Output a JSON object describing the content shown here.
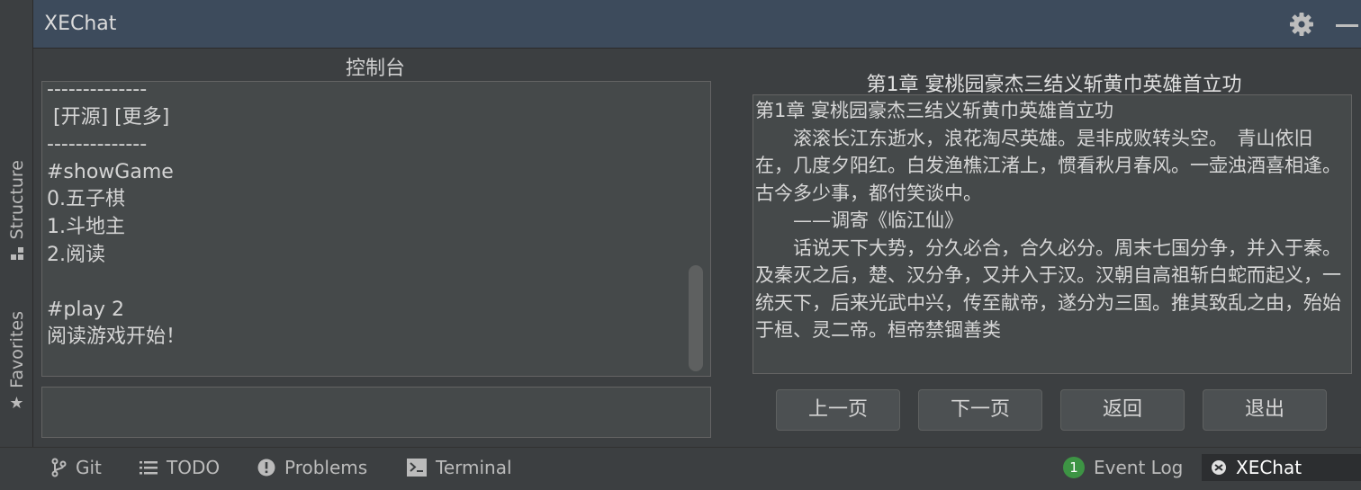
{
  "window": {
    "title": "XEChat",
    "gear_icon": "gear-icon",
    "minimize_icon": "minimize-icon"
  },
  "left_strip": {
    "structure_label": "Structure",
    "favorites_label": "Favorites"
  },
  "console": {
    "heading": "控制台",
    "lines": [
      "--------------",
      " [开源] [更多]",
      "--------------",
      "#showGame",
      "0.五子棋",
      "1.斗地主",
      "2.阅读",
      "",
      "#play 2",
      "阅读游戏开始！"
    ],
    "input_value": ""
  },
  "reader": {
    "heading": "第1章 宴桃园豪杰三结义斩黄巾英雄首立功",
    "paragraphs": [
      "第1章 宴桃园豪杰三结义斩黄巾英雄首立功",
      "　　滚滚长江东逝水，浪花淘尽英雄。是非成败转头空。　青山依旧在，几度夕阳红。白发渔樵江渚上，惯看秋月春风。一壶浊酒喜相逢。古今多少事，都付笑谈中。",
      "　　——调寄《临江仙》",
      "　　话说天下大势，分久必合，合久必分。周末七国分争，并入于秦。及秦灭之后，楚、汉分争，又并入于汉。汉朝自高祖斩白蛇而起义，一统天下，后来光武中兴，传至献帝，遂分为三国。推其致乱之由，殆始于桓、灵二帝。桓帝禁锢善类"
    ],
    "buttons": {
      "prev": "上一页",
      "next": "下一页",
      "back": "返回",
      "exit": "退出"
    }
  },
  "statusbar": {
    "git": "Git",
    "todo": "TODO",
    "problems": "Problems",
    "terminal": "Terminal",
    "event_log": "Event Log",
    "event_log_count": "1",
    "xechat": "XEChat"
  },
  "colors": {
    "title_bar": "#3d4b5c",
    "background": "#3c3f41",
    "panel": "#45494a",
    "event_badge": "#3d9444"
  }
}
